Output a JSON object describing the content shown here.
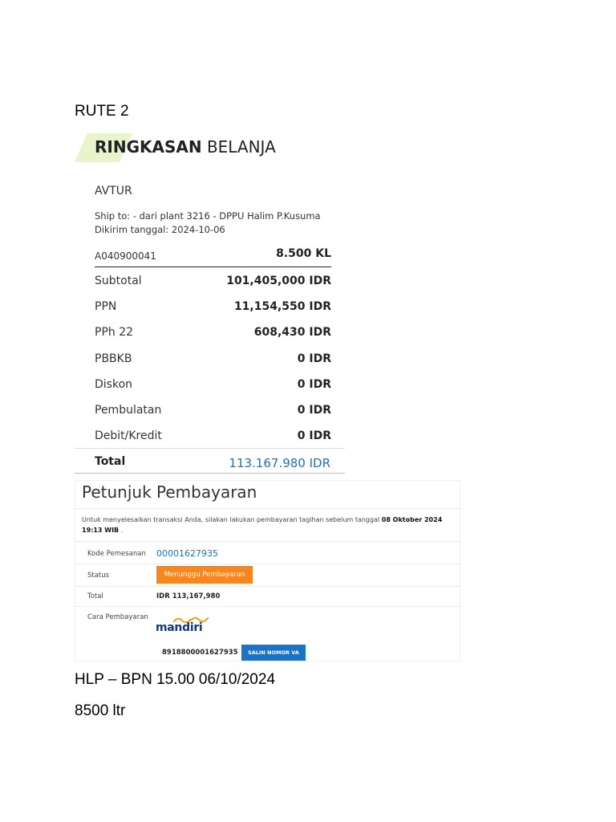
{
  "document": {
    "heading": "RUTE 2",
    "line1": "HLP – BPN 15.00 06/10/2024",
    "line2": "8500 ltr"
  },
  "summary": {
    "title_bold": "RINGKASAN",
    "title_rest": " BELANJA",
    "product": "AVTUR",
    "ship_to": "Ship to: - dari plant 3216 - DPPU Halim P.Kusuma",
    "sent_date": "Dikirim tanggal: 2024-10-06",
    "item_code": "A040900041",
    "item_qty": "8.500 KL",
    "fees": [
      {
        "label": "Subtotal",
        "value": "101,405,000 IDR"
      },
      {
        "label": "PPN",
        "value": "11,154,550 IDR"
      },
      {
        "label": "PPh 22",
        "value": "608,430 IDR"
      },
      {
        "label": "PBBKB",
        "value": "0 IDR"
      },
      {
        "label": "Diskon",
        "value": "0 IDR"
      },
      {
        "label": "Pembulatan",
        "value": "0 IDR"
      },
      {
        "label": "Debit/Kredit",
        "value": "0 IDR"
      }
    ],
    "total_label": "Total",
    "total_value": "113.167.980 IDR",
    "accent_color": "#e9f3cc",
    "total_color": "#1a73c7"
  },
  "payment": {
    "title": "Petunjuk Pembayaran",
    "instruction": "Untuk menyelesaikan transaksi Anda, silakan lakukan pembayaran tagihan sebelum tanggal",
    "deadline": "08 Oktober 2024 19:13 WIB",
    "instruction_end": ".",
    "order_label": "Kode Pemesanan",
    "order_number": "00001627935",
    "status_label": "Status",
    "status_value": "Menunggu Pembayaran",
    "total_label": "Total",
    "total_value": "IDR 113,167,980",
    "method_label": "Cara Pembayaran",
    "bank_name": "mandiri",
    "bank_logo_icon": "mandiri-wave-logo",
    "va_number": "8918800001627935",
    "copy_button": "SALIN NOMOR VA",
    "status_color": "#f7861e",
    "button_color": "#1a73c7"
  }
}
